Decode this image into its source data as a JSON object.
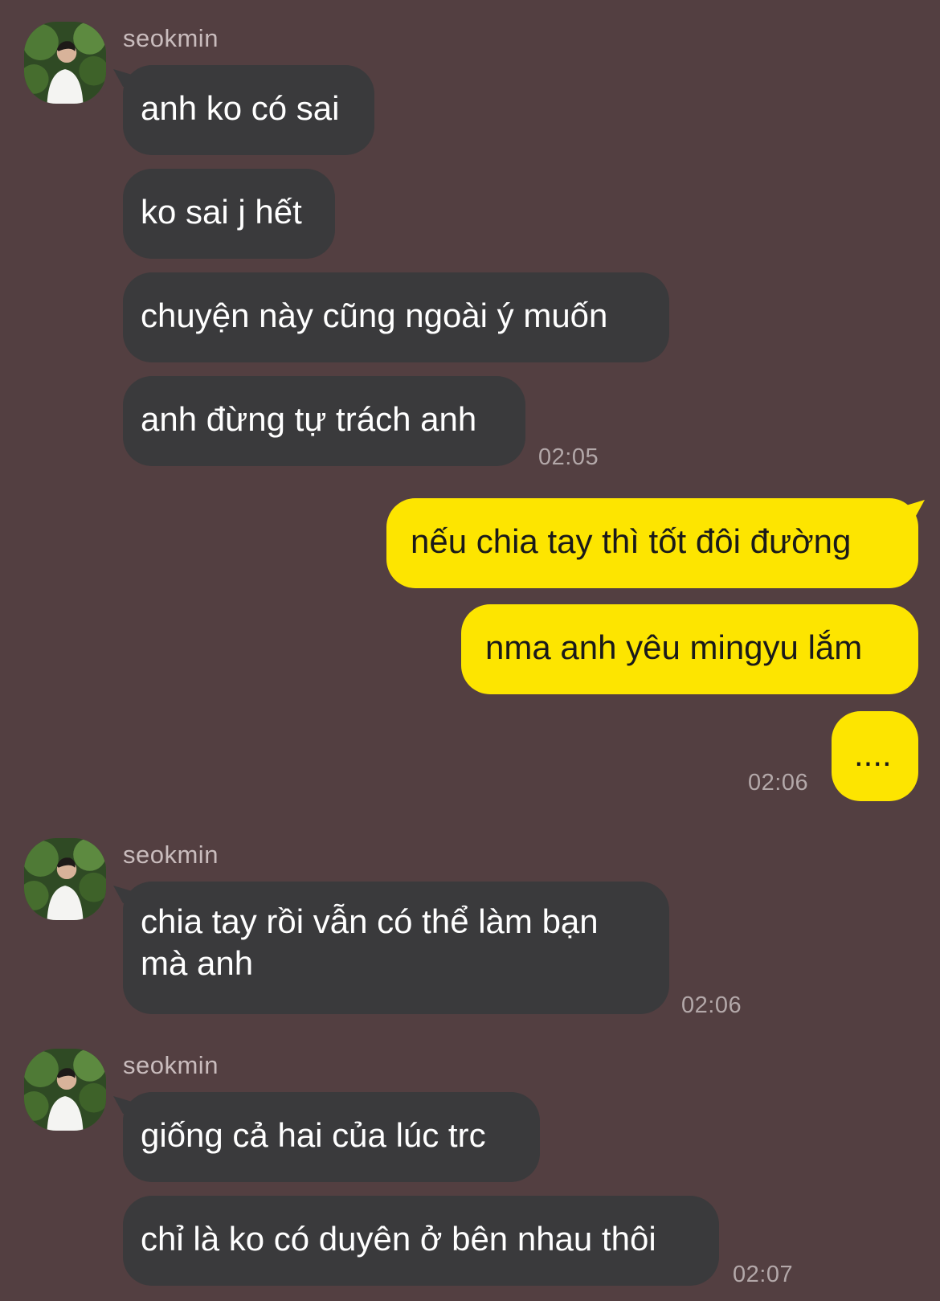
{
  "colors": {
    "background": "#533f41",
    "incoming_bubble": "#3a3a3c",
    "outgoing_bubble": "#fde500"
  },
  "groups": [
    {
      "sender": "seokmin",
      "avatar_icon": "profile-photo",
      "messages": [
        "anh ko có sai",
        "ko sai j hết",
        "chuyện này cũng ngoài ý muốn",
        "anh đừng tự trách anh"
      ],
      "time": "02:05"
    },
    {
      "sender": "me",
      "messages": [
        "nếu chia tay thì tốt đôi đường",
        "nma anh yêu mingyu lắm",
        "...."
      ],
      "time": "02:06"
    },
    {
      "sender": "seokmin",
      "avatar_icon": "profile-photo",
      "messages": [
        "chia tay rồi vẫn có thể làm bạn mà anh"
      ],
      "time": "02:06"
    },
    {
      "sender": "seokmin",
      "avatar_icon": "profile-photo",
      "messages": [
        "giống cả hai của lúc trc",
        "chỉ là ko có duyên ở bên nhau thôi"
      ],
      "time": "02:07"
    }
  ]
}
